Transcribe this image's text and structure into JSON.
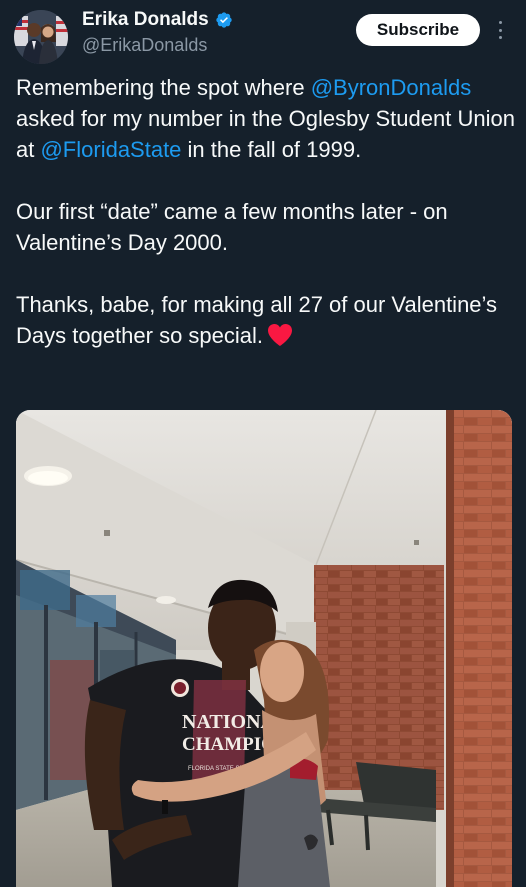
{
  "author": {
    "display_name": "Erika Donalds",
    "handle": "@ErikaDonalds",
    "verified": true,
    "avatar_icon": "profile-photo"
  },
  "header": {
    "subscribe_label": "Subscribe",
    "more_icon": "more-vertical-icon"
  },
  "tweet": {
    "p1_before": "Remembering the spot where ",
    "mention1": "@ByronDonalds",
    "p1_middle": " asked for my number in the Oglesby Student Union at ",
    "mention2": "@FloridaState",
    "p1_after": " in the fall of 1999.",
    "p2": "Our first “date” came a few months later - on Valentine’s Day 2000.",
    "p3": "Thanks, babe, for making all 27 of our Valentine’s Days together so special.",
    "emoji": "red-heart"
  },
  "photo": {
    "shirt_line1": "NATIONAL",
    "shirt_line2": "CHAMPIONS",
    "shirt_line3": "FLORIDA STATE SEMINOLES"
  },
  "colors": {
    "background": "#15202b",
    "text": "#f7f9f9",
    "secondary_text": "#8b98a5",
    "link": "#1d9bf0",
    "verified": "#1d9bf0",
    "heart": "#f91842",
    "button_bg": "#ffffff"
  }
}
